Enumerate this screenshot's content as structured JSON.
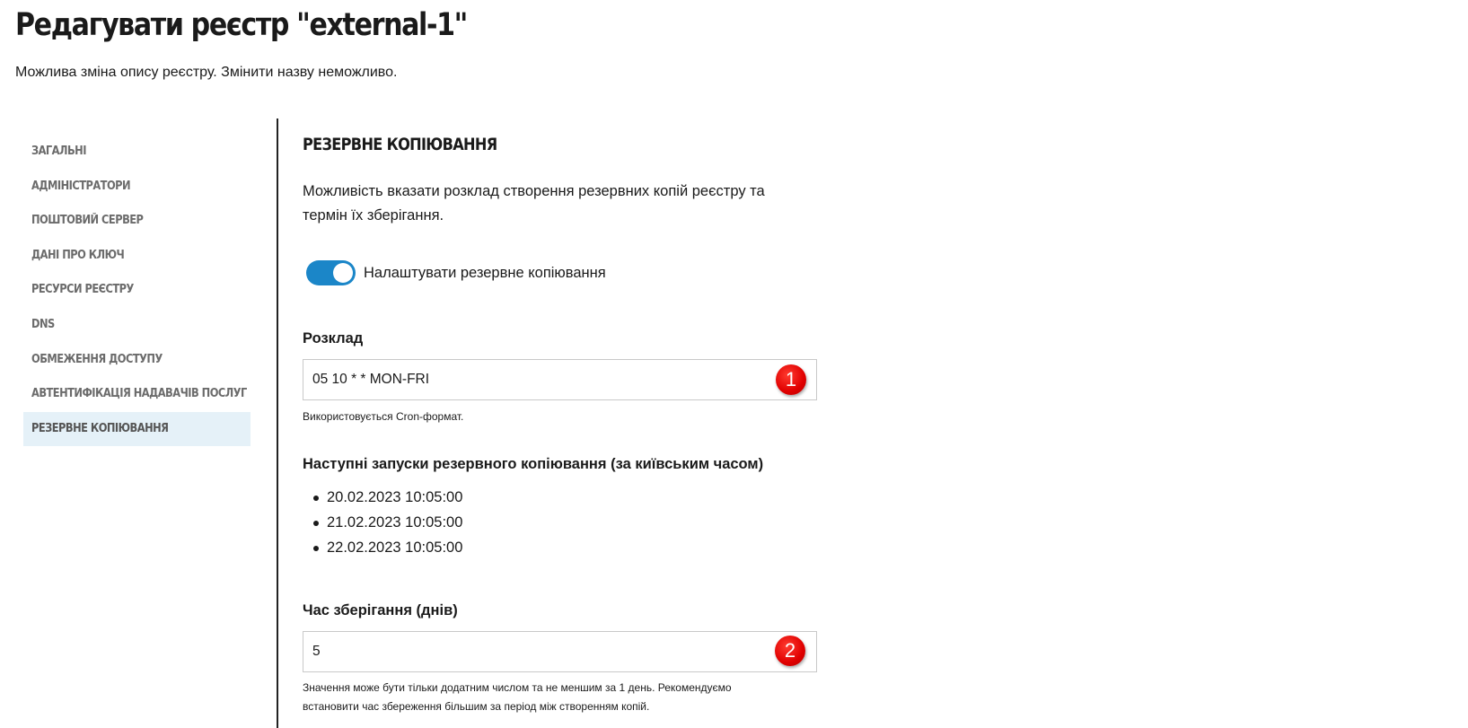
{
  "page": {
    "title": "Редагувати реєстр \"external-1\"",
    "subtitle": "Можлива зміна опису реєстру. Змінити назву неможливо."
  },
  "sidebar": {
    "items": [
      {
        "label": "ЗАГАЛЬНІ"
      },
      {
        "label": "АДМІНІСТРАТОРИ"
      },
      {
        "label": "ПОШТОВИЙ СЕРВЕР"
      },
      {
        "label": "ДАНІ ПРО КЛЮЧ"
      },
      {
        "label": "РЕСУРСИ РЕЄСТРУ"
      },
      {
        "label": "DNS"
      },
      {
        "label": "ОБМЕЖЕННЯ ДОСТУПУ"
      },
      {
        "label": "АВТЕНТИФІКАЦІЯ НАДАВАЧІВ ПОСЛУГ"
      },
      {
        "label": "РЕЗЕРВНЕ КОПІЮВАННЯ",
        "active": true
      }
    ]
  },
  "section": {
    "title": "РЕЗЕРВНЕ КОПІЮВАННЯ",
    "description": "Можливість вказати розклад створення резервних копій реєстру та термін їх зберігання.",
    "toggle": {
      "label": "Налаштувати резервне копіювання",
      "enabled": true,
      "color": "#1b86c8"
    },
    "schedule": {
      "label": "Розклад",
      "value": "05 10 * * MON-FRI",
      "hint": "Використовується Cron-формат.",
      "badge": "1"
    },
    "next_runs": {
      "label": "Наступні запуски резервного копіювання (за київським часом)",
      "items": [
        "20.02.2023 10:05:00",
        "21.02.2023 10:05:00",
        "22.02.2023 10:05:00"
      ]
    },
    "retention": {
      "label": "Час зберігання (днів)",
      "value": "5",
      "hint": "Значення може бути тільки додатним числом та не меншим за 1 день. Рекомендуємо встановити час збереження більшим за період між створенням копій.",
      "badge": "2"
    }
  }
}
